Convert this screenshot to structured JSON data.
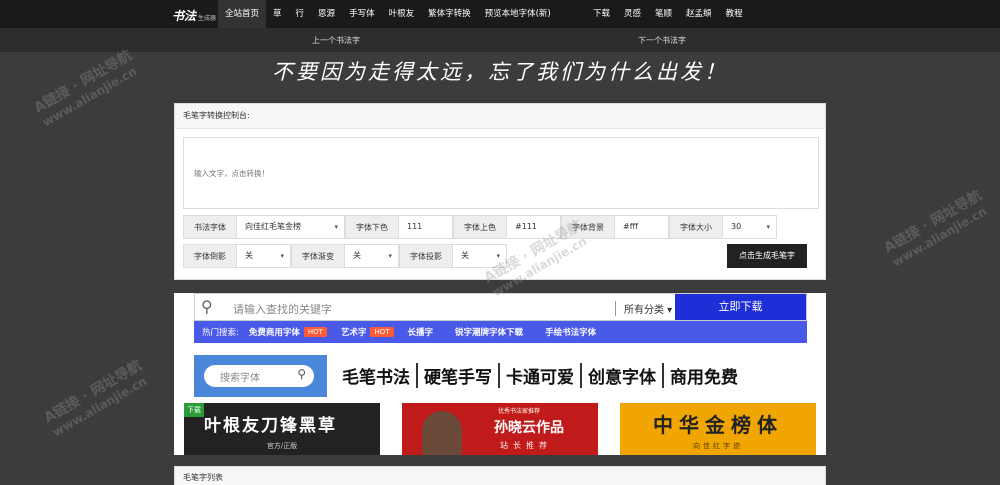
{
  "nav": {
    "logo_big": "书法",
    "logo_small": "生成器",
    "items": [
      "全站首页",
      "草",
      "行",
      "恩源",
      "手写体",
      "叶根友",
      "繁体字转换",
      "预览本地字体(新)"
    ],
    "items_right": [
      "下载",
      "灵感",
      "笔顺",
      "赵孟頫",
      "教程"
    ],
    "prev": "上一个书法字",
    "next": "下一个书法字"
  },
  "slogan": "不要因为走得太远，忘了我们为什么出发！",
  "panel": {
    "title": "毛笔字转换控制台:",
    "input_placeholder": "输入文字，点击转换！",
    "fields_row1": [
      {
        "label": "书法字体",
        "value": "向佳红毛笔金榜",
        "dropdown": true
      },
      {
        "label": "字体下色",
        "value": "111",
        "dropdown": false
      },
      {
        "label": "字体上色",
        "value": "#111",
        "dropdown": false
      },
      {
        "label": "字体背景",
        "value": "#fff",
        "dropdown": false
      },
      {
        "label": "字体大小",
        "value": "30",
        "dropdown": true
      }
    ],
    "fields_row2": [
      {
        "label": "字体倒影",
        "value": "关",
        "dropdown": true
      },
      {
        "label": "字体渐变",
        "value": "关",
        "dropdown": true
      },
      {
        "label": "字体投影",
        "value": "关",
        "dropdown": true
      }
    ],
    "generate": "点击生成毛笔字"
  },
  "ad": {
    "search_placeholder": "请输入查找的关键字",
    "category": "所有分类",
    "download": "立即下载",
    "hot_label": "热门搜索:",
    "hot_items": [
      "免费商用字体",
      "艺术字",
      "长播字",
      "锐字潮牌字体下载",
      "手绘书法字体"
    ],
    "hot_badge": "HOT",
    "search_font": "搜索字体",
    "categories": [
      "毛笔书法",
      "硬笔手写",
      "卡通可爱",
      "创意字体",
      "商用免费"
    ],
    "card1_tag": "下载",
    "card1_title": "叶根友刀锋黑草",
    "card1_sub": "官方/正版",
    "card2_kicker": "优秀书法家推荐",
    "card2_title": "孙晓云作品",
    "card2_sub": "站长推荐",
    "card3_title": "中华金榜体",
    "card3_sub": "向佳红字迹"
  },
  "list": {
    "title": "毛笔字列表"
  },
  "watermark": {
    "line1": "A链接 · 网址导航",
    "line2": "www.alianjie.cn"
  }
}
